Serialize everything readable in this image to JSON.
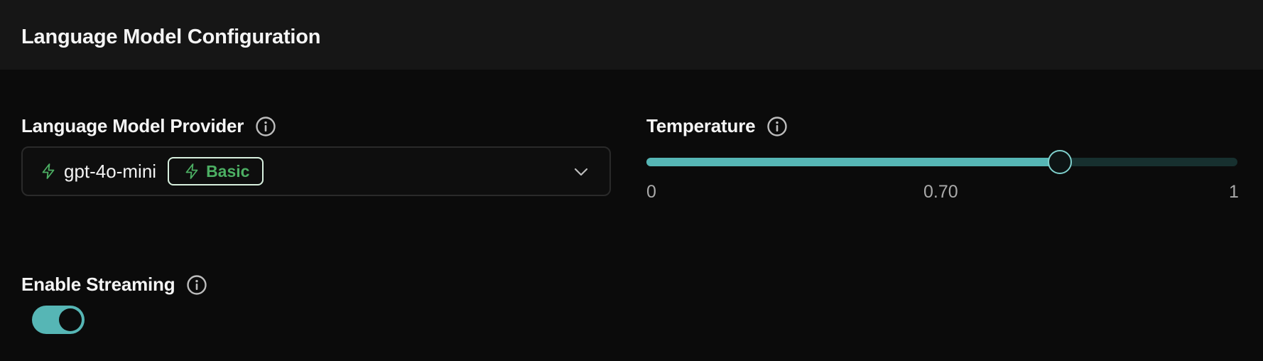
{
  "header": {
    "title": "Language Model Configuration"
  },
  "provider": {
    "label": "Language Model Provider",
    "info_icon": "info-icon",
    "selected_value": "gpt-4o-mini",
    "value_icon": "lightning-icon",
    "badge": {
      "label": "Basic",
      "icon": "lightning-icon",
      "color": "#4caf63"
    },
    "dropdown_icon": "chevron-down-icon"
  },
  "temperature": {
    "label": "Temperature",
    "info_icon": "info-icon",
    "min_label": "0",
    "value_label": "0.70",
    "max_label": "1",
    "value": 0.7,
    "min": 0,
    "max": 1,
    "accent_color": "#56b6b5"
  },
  "streaming": {
    "label": "Enable Streaming",
    "info_icon": "info-icon",
    "enabled": true,
    "accent_color": "#56b6b5"
  }
}
